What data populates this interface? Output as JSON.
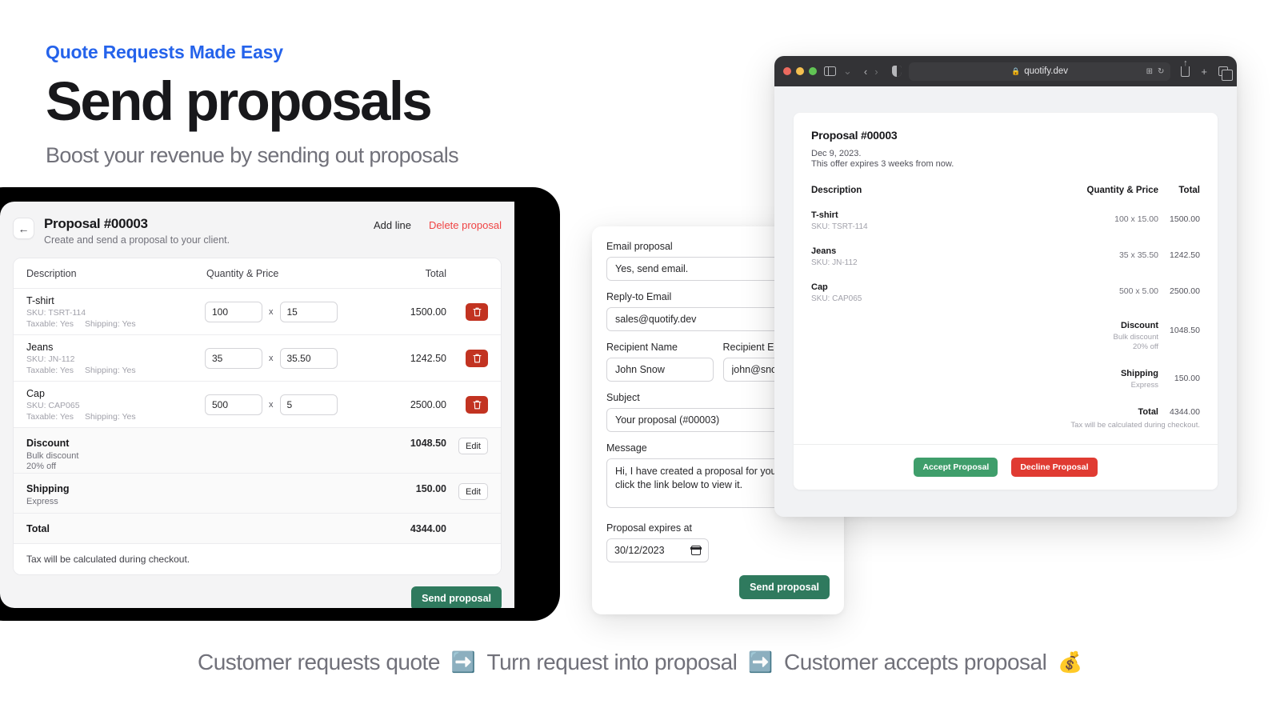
{
  "hero": {
    "eyebrow": "Quote Requests Made Easy",
    "title": "Send proposals",
    "subtitle": "Boost your revenue by sending out proposals"
  },
  "editor": {
    "back_icon": "arrow-left-icon",
    "title": "Proposal #00003",
    "description": "Create and send a proposal to your client.",
    "add_line_label": "Add line",
    "delete_label": "Delete proposal",
    "columns": {
      "description": "Description",
      "quantity_price": "Quantity & Price",
      "total": "Total"
    },
    "multiply_symbol": "x",
    "items": [
      {
        "name": "T-shirt",
        "sku": "SKU: TSRT-114",
        "taxable": "Taxable: Yes",
        "shipping": "Shipping: Yes",
        "qty": "100",
        "price": "15",
        "total": "1500.00",
        "delete_icon": "trash-icon"
      },
      {
        "name": "Jeans",
        "sku": "SKU: JN-112",
        "taxable": "Taxable: Yes",
        "shipping": "Shipping: Yes",
        "qty": "35",
        "price": "35.50",
        "total": "1242.50",
        "delete_icon": "trash-icon"
      },
      {
        "name": "Cap",
        "sku": "SKU: CAP065",
        "taxable": "Taxable: Yes",
        "shipping": "Shipping: Yes",
        "qty": "500",
        "price": "5",
        "total": "2500.00",
        "delete_icon": "trash-icon"
      }
    ],
    "discount": {
      "label": "Discount",
      "line1": "Bulk discount",
      "line2": "20% off",
      "amount": "1048.50",
      "edit_label": "Edit"
    },
    "shipping": {
      "label": "Shipping",
      "line1": "Express",
      "amount": "150.00",
      "edit_label": "Edit"
    },
    "total": {
      "label": "Total",
      "amount": "4344.00"
    },
    "tax_note": "Tax will be calculated during checkout.",
    "send_label": "Send proposal"
  },
  "email_form": {
    "email_proposal_label": "Email proposal",
    "email_proposal_value": "Yes, send email.",
    "select_icon": "chevron-updown-icon",
    "reply_to_label": "Reply-to Email",
    "reply_to_value": "sales@quotify.dev",
    "recipient_name_label": "Recipient Name",
    "recipient_name_value": "John Snow",
    "recipient_email_label": "Recipient Email",
    "recipient_email_value": "john@snowinc.com",
    "subject_label": "Subject",
    "subject_value": "Your proposal (#00003)",
    "message_label": "Message",
    "message_value": "Hi, I have created a proposal for you. Please click the link below to view it.",
    "expires_label": "Proposal expires at",
    "expires_value": "30/12/2023",
    "calendar_icon": "calendar-icon",
    "send_label": "Send proposal"
  },
  "browser": {
    "url": "quotify.dev",
    "lock_icon": "lock-icon",
    "sidebar_icon": "sidebar-icon",
    "chevron_icon": "chevron-down-icon",
    "back_icon": "chevron-left-icon",
    "forward_icon": "chevron-right-icon",
    "shield_icon": "privacy-shield-icon",
    "extensions_icon": "extensions-icon",
    "reload_icon": "reload-icon",
    "share_icon": "share-icon",
    "newtab_icon": "plus-icon",
    "tabs_icon": "tab-overview-icon"
  },
  "preview": {
    "title": "Proposal #00003",
    "date": "Dec 9, 2023.",
    "expires": "This offer expires 3 weeks from now.",
    "columns": {
      "description": "Description",
      "quantity_price": "Quantity & Price",
      "total": "Total"
    },
    "items": [
      {
        "name": "T-shirt",
        "sku": "SKU: TSRT-114",
        "qty_price": "100 x 15.00",
        "total": "1500.00"
      },
      {
        "name": "Jeans",
        "sku": "SKU: JN-112",
        "qty_price": "35 x 35.50",
        "total": "1242.50"
      },
      {
        "name": "Cap",
        "sku": "SKU: CAP065",
        "qty_price": "500 x 5.00",
        "total": "2500.00"
      }
    ],
    "discount": {
      "label": "Discount",
      "line1": "Bulk discount",
      "line2": "20% off",
      "amount": "1048.50"
    },
    "shipping": {
      "label": "Shipping",
      "line1": "Express",
      "amount": "150.00"
    },
    "total": {
      "label": "Total",
      "amount": "4344.00"
    },
    "tax_note": "Tax will be calculated during checkout.",
    "accept_label": "Accept Proposal",
    "decline_label": "Decline Proposal"
  },
  "caption": {
    "step1": "Customer requests quote",
    "arrow1": "➡️",
    "step2": "Turn request into proposal",
    "arrow2": "➡️",
    "step3": "Customer accepts proposal",
    "money": "💰"
  },
  "colors": {
    "accent_blue": "#2563eb",
    "green": "#2f7a5e",
    "red": "#c23321",
    "accept_green": "#3f9e6b",
    "decline_red": "#e03b32",
    "danger_text": "#ef4444"
  }
}
